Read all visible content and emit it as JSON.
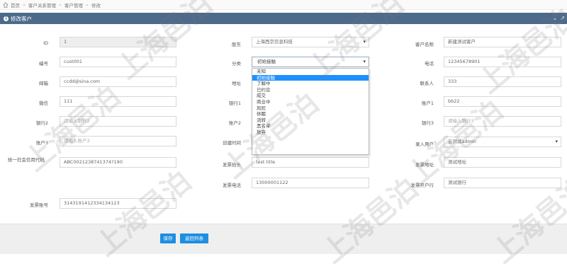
{
  "breadcrumb": [
    "首页",
    "客户关系管理",
    "客户管理",
    "修改"
  ],
  "panel": {
    "title": "修改客户"
  },
  "fields": {
    "id": {
      "label": "ID",
      "value": "1"
    },
    "code": {
      "label": "编号",
      "value": "cust001"
    },
    "email": {
      "label": "邮箱",
      "value": "ccdd@sina.com"
    },
    "wechat": {
      "label": "微信",
      "value": "111"
    },
    "bank2": {
      "label": "银行2",
      "placeholder": "请输入银行2"
    },
    "account3": {
      "label": "账户3",
      "placeholder": "请输入账户3"
    },
    "credit_code": {
      "label": "统一社会信用代码",
      "value": "ABC0021238741374?190"
    },
    "invoice_account": {
      "label": "发票账号",
      "value": "3143191412334134123"
    },
    "shareholder": {
      "label": "股东",
      "value": "上海西京信息科技"
    },
    "category": {
      "label": "分类",
      "value": "初始接触"
    },
    "address": {
      "label": "地址"
    },
    "bank1": {
      "label": "银行1"
    },
    "account2": {
      "label": "账户2"
    },
    "created_time": {
      "label": "创建时间"
    },
    "invoice_title": {
      "label": "发票抬头",
      "value": "test title"
    },
    "invoice_phone": {
      "label": "发票电话",
      "value": "13000001122"
    },
    "customer_name": {
      "label": "客户名称",
      "value": "新建测试客户"
    },
    "phone": {
      "label": "电话",
      "value": "12345678901"
    },
    "contact": {
      "label": "联系人",
      "value": "333"
    },
    "account1": {
      "label": "账户1",
      "value": "bb22"
    },
    "bank3": {
      "label": "银行3",
      "placeholder": "请输入银行3"
    },
    "entry_user": {
      "label": "录入用户",
      "value": "云测试admin"
    },
    "invoice_address": {
      "label": "发票地址",
      "value": "测试地址"
    },
    "invoice_bank": {
      "label": "发票开户行",
      "value": "测试银行"
    }
  },
  "category_options": [
    "未知",
    "初始接触",
    "了解中",
    "已约见",
    "成交",
    "商业中",
    "风险",
    "休眠",
    "流转",
    "黑名单",
    "放弃"
  ],
  "category_selected_index": 1,
  "buttons": {
    "save": "保存",
    "back": "返回列表"
  },
  "watermark_text": "上海邑泊",
  "colors": {
    "header": "#4e6a8a",
    "accent": "#1e8fe1",
    "selected_option": "#1e90ff"
  }
}
